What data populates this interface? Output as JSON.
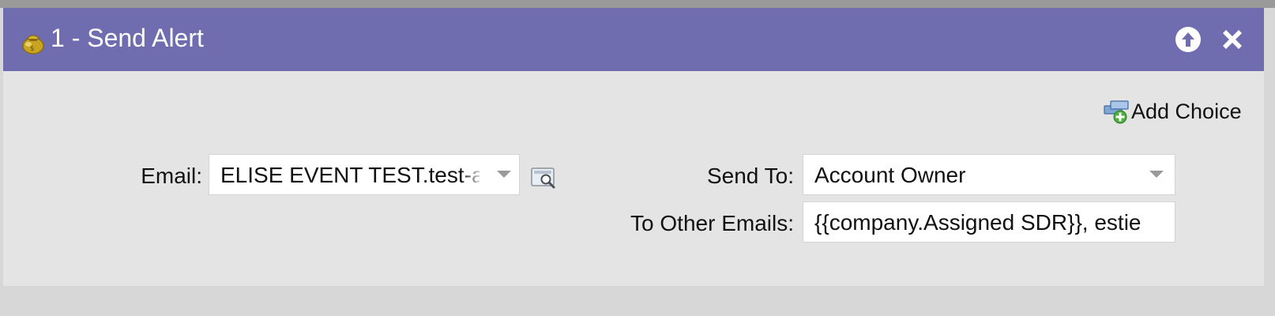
{
  "dialog": {
    "title": "1 - Send Alert",
    "header_color": "#6f6db0",
    "icons": {
      "title_icon": "money-bag-icon",
      "collapse": "arrow-up-circle-icon",
      "close": "close-x-icon"
    }
  },
  "toolbar": {
    "add_choice_label": "Add Choice",
    "add_choice_icon": "add-choice-icon"
  },
  "form": {
    "email": {
      "label": "Email:",
      "value": "ELISE EVENT TEST.test-alert",
      "preview_icon": "magnifier-preview-icon"
    },
    "send_to": {
      "label": "Send To:",
      "value": "Account Owner"
    },
    "other_emails": {
      "label": "To Other Emails:",
      "value": "{{company.Assigned SDR}}, estie"
    }
  }
}
